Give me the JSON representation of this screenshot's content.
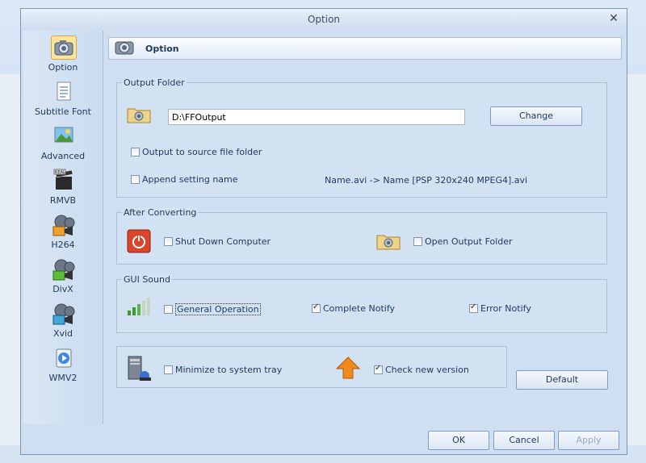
{
  "window": {
    "title": "Option"
  },
  "nav": {
    "items": [
      {
        "label": "Option",
        "selected": true
      },
      {
        "label": "Subtitle Font"
      },
      {
        "label": "Advanced"
      },
      {
        "label": "RMVB"
      },
      {
        "label": "H264"
      },
      {
        "label": "DivX"
      },
      {
        "label": "Xvid"
      },
      {
        "label": "WMV2"
      }
    ]
  },
  "header": {
    "title": "Option"
  },
  "output_folder": {
    "label": "Output Folder",
    "path_value": "D:\\FFOutput",
    "change_label": "Change",
    "output_to_source_label": "Output to source file folder",
    "output_to_source_checked": false,
    "append_setting_label": "Append setting name",
    "append_setting_checked": false,
    "name_example": "Name.avi  -> Name [PSP 320x240 MPEG4].avi"
  },
  "after_converting": {
    "label": "After Converting",
    "shutdown_label": "Shut Down Computer",
    "shutdown_checked": false,
    "open_folder_label": "Open Output Folder",
    "open_folder_checked": false
  },
  "gui_sound": {
    "label": "GUI Sound",
    "general_label": "General Operation",
    "general_checked": false,
    "complete_label": "Complete Notify",
    "complete_checked": true,
    "error_label": "Error Notify",
    "error_checked": true
  },
  "misc": {
    "minimize_label": "Minimize to system tray",
    "minimize_checked": false,
    "check_version_label": "Check new version",
    "check_version_checked": true,
    "default_label": "Default"
  },
  "footer": {
    "ok_label": "OK",
    "cancel_label": "Cancel",
    "apply_label": "Apply"
  },
  "colors": {
    "accent": "#1e395b",
    "shutdown_red": "#d9442a",
    "arrow_orange": "#f08a1c"
  }
}
